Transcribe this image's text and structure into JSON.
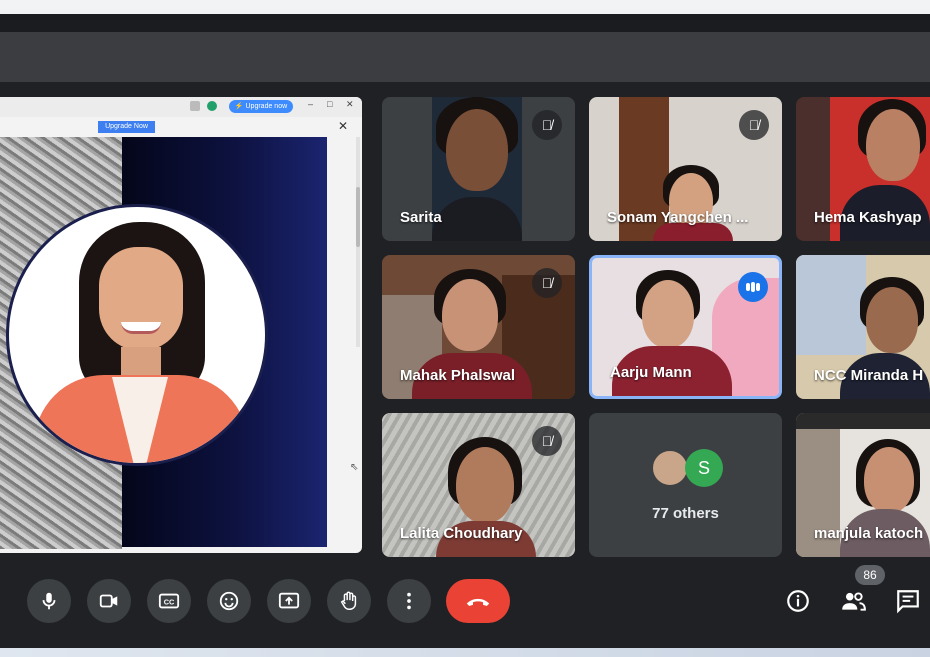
{
  "shared_screen": {
    "top_upgrade_label": "⚡ Upgrade now",
    "upgrade_button_label": "Upgrade Now",
    "close_glyph": "✕"
  },
  "participants": [
    {
      "name": "Sarita",
      "muted": true
    },
    {
      "name": "Sonam Yangchen ...",
      "muted": true
    },
    {
      "name": "Hema Kashyap",
      "muted": false
    },
    {
      "name": "Mahak Phalswal",
      "muted": true
    },
    {
      "name": "Aarju Mann",
      "muted": false,
      "speaking": true
    },
    {
      "name": "NCC Miranda H",
      "muted": false
    },
    {
      "name": "Lalita Choudhary",
      "muted": true
    },
    {
      "name": "manjula katoch",
      "muted": false
    }
  ],
  "others": {
    "avatar_letter": "S",
    "label": "77 others",
    "avatar_color": "#34a853"
  },
  "controls": {
    "mic": "microphone-icon",
    "camera": "camera-icon",
    "captions_label": "CC",
    "emoji": "emoji-icon",
    "present": "present-icon",
    "raise_hand": "hand-icon",
    "more": "more-vert-icon",
    "hangup": "hangup-icon"
  },
  "right_controls": {
    "people_count": "86"
  },
  "colors": {
    "accent": "#1a73e8",
    "hangup": "#ea4335",
    "background": "#202124"
  }
}
